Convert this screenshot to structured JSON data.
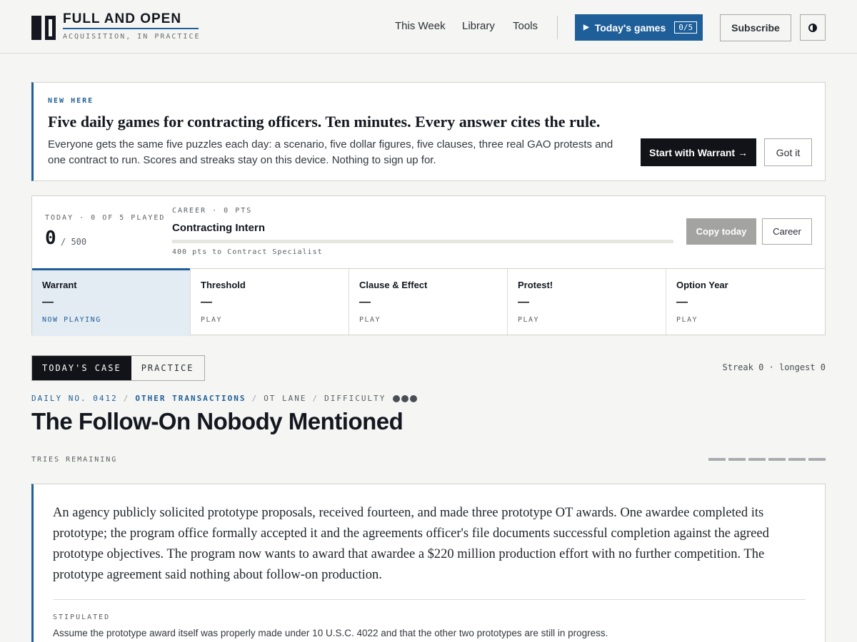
{
  "brand": {
    "title": "FULL AND OPEN",
    "subtitle": "ACQUISITION, IN PRACTICE"
  },
  "nav": {
    "items": [
      "This Week",
      "Library",
      "Tools"
    ]
  },
  "header": {
    "games_button": {
      "label": "Today's games",
      "count": "0/5"
    },
    "subscribe_label": "Subscribe",
    "theme_icon": "contrast-icon"
  },
  "welcome": {
    "eyebrow": "NEW HERE",
    "headline": "Five daily games for contracting officers. Ten minutes. Every answer cites the rule.",
    "body": "Everyone gets the same five puzzles each day: a scenario, five dollar figures, five clauses, three real GAO protests and one contract to run. Scores and streaks stay on this device. Nothing to sign up for.",
    "start_label": "Start with Warrant →",
    "dismiss_label": "Got it"
  },
  "score": {
    "today_label": "TODAY · 0 OF 5 PLAYED",
    "today_value": "0",
    "today_max": "/ 500",
    "career_label": "CAREER · 0 PTS",
    "rank": "Contracting Intern",
    "progress": 0,
    "next_rank": "400 pts to Contract Specialist",
    "copy_label": "Copy today",
    "career_button": "Career"
  },
  "games": [
    {
      "name": "Warrant",
      "score": "—",
      "state": "NOW PLAYING"
    },
    {
      "name": "Threshold",
      "score": "—",
      "state": "PLAY"
    },
    {
      "name": "Clause & Effect",
      "score": "—",
      "state": "PLAY"
    },
    {
      "name": "Protest!",
      "score": "—",
      "state": "PLAY"
    },
    {
      "name": "Option Year",
      "score": "—",
      "state": "PLAY"
    }
  ],
  "modes": [
    "TODAY'S CASE",
    "PRACTICE"
  ],
  "streak": "Streak 0 · longest 0",
  "case": {
    "daily": "DAILY NO. 0412",
    "category": "OTHER TRANSACTIONS",
    "lane": "OT LANE",
    "difficulty_label": "DIFFICULTY",
    "difficulty": 3,
    "title": "The Follow-On Nobody Mentioned",
    "tries_label": "TRIES REMAINING",
    "tries_remaining": 6,
    "prompt": "An agency publicly solicited prototype proposals, received fourteen, and made three prototype OT awards. One awardee completed its prototype; the program office formally accepted it and the agreements officer's file documents successful completion against the agreed prototype objectives. The program now wants to award that awardee a $220 million production effort with no further competition. The prototype agreement said nothing about follow-on production.",
    "stipulated_label": "STIPULATED",
    "stipulated": "Assume the prototype award itself was properly made under 10 U.S.C. 4022 and that the other two prototypes are still in progress."
  },
  "colors": {
    "accent": "#1f5f99",
    "dark": "#111318",
    "background": "#f5f5f3"
  }
}
